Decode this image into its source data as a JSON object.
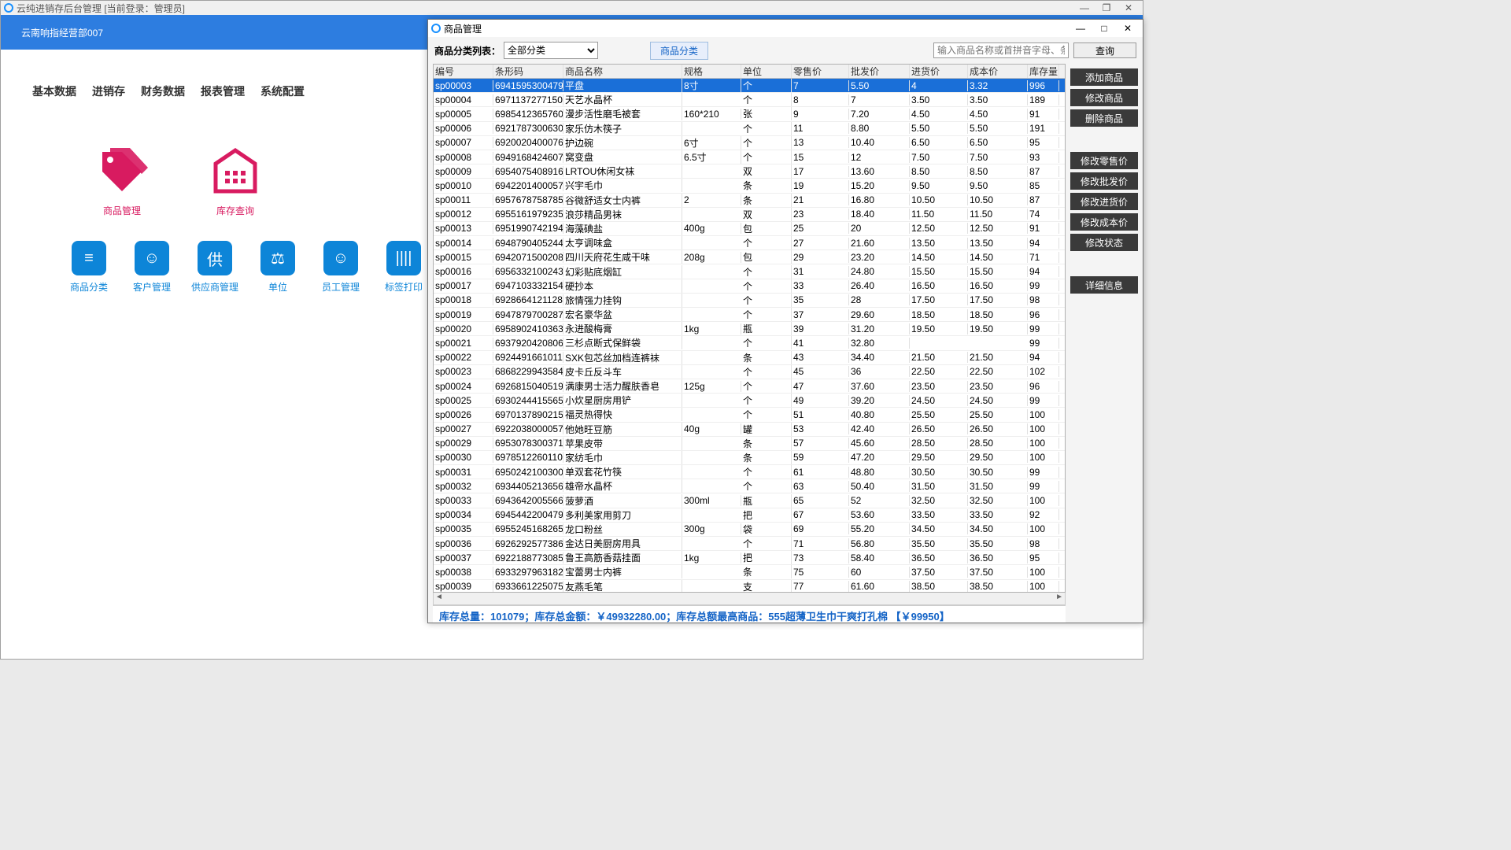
{
  "main_title": "云纯进销存后台管理 [当前登录：管理员]",
  "header": "云南响指经营部007",
  "tabs": [
    "基本数据",
    "进销存",
    "财务数据",
    "报表管理",
    "系统配置"
  ],
  "big": [
    {
      "label": "商品管理"
    },
    {
      "label": "库存查询"
    }
  ],
  "small": [
    {
      "label": "商品分类",
      "g": "≡"
    },
    {
      "label": "客户管理",
      "g": "☺"
    },
    {
      "label": "供应商管理",
      "g": "供"
    },
    {
      "label": "单位",
      "g": "⚖"
    },
    {
      "label": "员工管理",
      "g": "☺☺"
    },
    {
      "label": "标签打印",
      "g": "||||"
    }
  ],
  "modal_title": "商品管理",
  "cat_label": "商品分类列表：",
  "cat_select": "全部分类",
  "cat_btn": "商品分类",
  "search_ph": "输入商品名称或首拼音字母、条形码",
  "query": "查询",
  "cols": [
    "编号",
    "条形码",
    "商品名称",
    "规格",
    "单位",
    "零售价",
    "批发价",
    "进货价",
    "成本价",
    "库存量"
  ],
  "rows": [
    [
      "sp00003",
      "6941595300479",
      "平盘",
      "8寸",
      "个",
      "7",
      "5.50",
      "4",
      "3.32",
      "996"
    ],
    [
      "sp00004",
      "6971137277150",
      "天艺水晶杯",
      "",
      "个",
      "8",
      "7",
      "3.50",
      "3.50",
      "189"
    ],
    [
      "sp00005",
      "6985412365760",
      "漫步活性磨毛被套",
      "160*210",
      "张",
      "9",
      "7.20",
      "4.50",
      "4.50",
      "91"
    ],
    [
      "sp00006",
      "6921787300630",
      "家乐仿木筷子",
      "",
      "个",
      "11",
      "8.80",
      "5.50",
      "5.50",
      "191"
    ],
    [
      "sp00007",
      "6920020400076",
      "护边碗",
      "6寸",
      "个",
      "13",
      "10.40",
      "6.50",
      "6.50",
      "95"
    ],
    [
      "sp00008",
      "6949168424607",
      "窝变盘",
      "6.5寸",
      "个",
      "15",
      "12",
      "7.50",
      "7.50",
      "93"
    ],
    [
      "sp00009",
      "6954075408916",
      "LRTOU休闲女袜",
      "",
      "双",
      "17",
      "13.60",
      "8.50",
      "8.50",
      "87"
    ],
    [
      "sp00010",
      "6942201400057",
      "兴宇毛巾",
      "",
      "条",
      "19",
      "15.20",
      "9.50",
      "9.50",
      "85"
    ],
    [
      "sp00011",
      "6957678758785",
      "谷微舒适女士内裤",
      "2",
      "条",
      "21",
      "16.80",
      "10.50",
      "10.50",
      "87"
    ],
    [
      "sp00012",
      "6955161979235",
      "浪莎精品男袜",
      "",
      "双",
      "23",
      "18.40",
      "11.50",
      "11.50",
      "74"
    ],
    [
      "sp00013",
      "6951990742194",
      "海藻碘盐",
      "400g",
      "包",
      "25",
      "20",
      "12.50",
      "12.50",
      "91"
    ],
    [
      "sp00014",
      "6948790405244",
      "太亨调味盒",
      "",
      "个",
      "27",
      "21.60",
      "13.50",
      "13.50",
      "94"
    ],
    [
      "sp00015",
      "6942071500208",
      "四川天府花生咸干味",
      "208g",
      "包",
      "29",
      "23.20",
      "14.50",
      "14.50",
      "71"
    ],
    [
      "sp00016",
      "6956332100243",
      "幻彩贴底烟缸",
      "",
      "个",
      "31",
      "24.80",
      "15.50",
      "15.50",
      "94"
    ],
    [
      "sp00017",
      "6947103332154",
      "硬抄本",
      "",
      "个",
      "33",
      "26.40",
      "16.50",
      "16.50",
      "99"
    ],
    [
      "sp00018",
      "6928664121128",
      "旅情强力挂钩",
      "",
      "个",
      "35",
      "28",
      "17.50",
      "17.50",
      "98"
    ],
    [
      "sp00019",
      "6947879700287",
      "宏名豪华盆",
      "",
      "个",
      "37",
      "29.60",
      "18.50",
      "18.50",
      "96"
    ],
    [
      "sp00020",
      "6958902410363",
      "永进酸梅膏",
      "1kg",
      "瓶",
      "39",
      "31.20",
      "19.50",
      "19.50",
      "99"
    ],
    [
      "sp00021",
      "6937920420806",
      "三杉点断式保鲜袋",
      "",
      "个",
      "41",
      "32.80",
      "",
      "",
      "99"
    ],
    [
      "sp00022",
      "6924491661011",
      "SXK包芯丝加档连裤袜",
      "",
      "条",
      "43",
      "34.40",
      "21.50",
      "21.50",
      "94"
    ],
    [
      "sp00023",
      "6868229943584",
      "皮卡丘反斗车",
      "",
      "个",
      "45",
      "36",
      "22.50",
      "22.50",
      "102"
    ],
    [
      "sp00024",
      "6926815040519",
      "满康男士活力醒肤香皂",
      "125g",
      "个",
      "47",
      "37.60",
      "23.50",
      "23.50",
      "96"
    ],
    [
      "sp00025",
      "6930244415565",
      "小炊星厨房用铲",
      "",
      "个",
      "49",
      "39.20",
      "24.50",
      "24.50",
      "99"
    ],
    [
      "sp00026",
      "6970137890215",
      "福灵热得快",
      "",
      "个",
      "51",
      "40.80",
      "25.50",
      "25.50",
      "100"
    ],
    [
      "sp00027",
      "6922038000057",
      "他她旺豆筋",
      "40g",
      "罐",
      "53",
      "42.40",
      "26.50",
      "26.50",
      "100"
    ],
    [
      "sp00029",
      "6953078300371",
      "苹果皮带",
      "",
      "条",
      "57",
      "45.60",
      "28.50",
      "28.50",
      "100"
    ],
    [
      "sp00030",
      "6978512260110",
      "家纺毛巾",
      "",
      "条",
      "59",
      "47.20",
      "29.50",
      "29.50",
      "100"
    ],
    [
      "sp00031",
      "6950242100300",
      "单双套花竹筷",
      "",
      "个",
      "61",
      "48.80",
      "30.50",
      "30.50",
      "99"
    ],
    [
      "sp00032",
      "6934405213656",
      "雄帝水晶杯",
      "",
      "个",
      "63",
      "50.40",
      "31.50",
      "31.50",
      "99"
    ],
    [
      "sp00033",
      "6943642005566",
      "菠萝酒",
      "300ml",
      "瓶",
      "65",
      "52",
      "32.50",
      "32.50",
      "100"
    ],
    [
      "sp00034",
      "6945442200479",
      "多利美家用剪刀",
      "",
      "把",
      "67",
      "53.60",
      "33.50",
      "33.50",
      "92"
    ],
    [
      "sp00035",
      "6955245168265",
      "龙口粉丝",
      "300g",
      "袋",
      "69",
      "55.20",
      "34.50",
      "34.50",
      "100"
    ],
    [
      "sp00036",
      "6926292577386",
      "金达日美厨房用具",
      "",
      "个",
      "71",
      "56.80",
      "35.50",
      "35.50",
      "98"
    ],
    [
      "sp00037",
      "6922188773085",
      "鲁王高筋香菇挂面",
      "1kg",
      "把",
      "73",
      "58.40",
      "36.50",
      "36.50",
      "95"
    ],
    [
      "sp00038",
      "6933297963182",
      "宝蕾男士内裤",
      "",
      "条",
      "75",
      "60",
      "37.50",
      "37.50",
      "100"
    ],
    [
      "sp00039",
      "6933661225075",
      "友燕毛笔",
      "",
      "支",
      "77",
      "61.60",
      "38.50",
      "38.50",
      "100"
    ]
  ],
  "side_top": [
    "添加商品",
    "修改商品",
    "删除商品"
  ],
  "side_mid": [
    "修改零售价",
    "修改批发价",
    "修改进货价",
    "修改成本价",
    "修改状态"
  ],
  "side_bot": [
    "详细信息"
  ],
  "status": "库存总量：101079；库存总金额：￥49932280.00；库存总额最高商品：555超薄卫生巾干爽打孔棉 【￥99950】",
  "chart_data": {
    "type": "table",
    "columns": [
      "编号",
      "条形码",
      "商品名称",
      "规格",
      "单位",
      "零售价",
      "批发价",
      "进货价",
      "成本价",
      "库存量"
    ]
  }
}
